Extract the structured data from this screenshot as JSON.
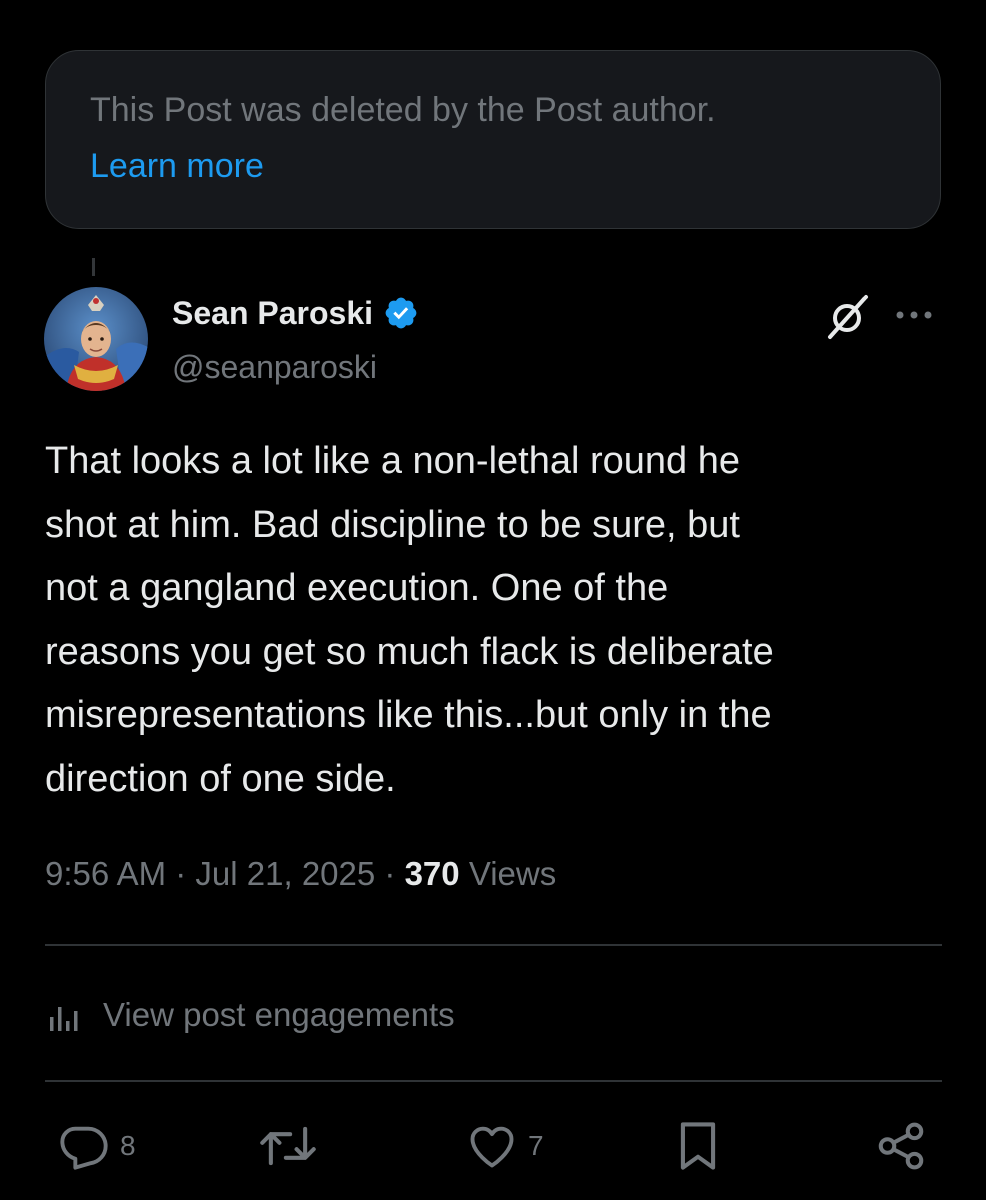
{
  "deleted_notice": {
    "text": "This Post was deleted by the Post author.",
    "link_label": "Learn more"
  },
  "author": {
    "name": "Sean Paroski",
    "handle": "@seanparoski",
    "verified": true,
    "avatar_icon": "avatar"
  },
  "post": {
    "text": "That looks a lot like a non-lethal round he\nshot at him. Bad discipline to be sure, but\nnot a gangland execution. One of the\nreasons you get so much flack is deliberate\nmisrepresentations like this...but only in the\ndirection of one side.",
    "time": "9:56 AM",
    "date": "Jul 21, 2025",
    "separator": "·",
    "views_count": "370",
    "views_label": "Views"
  },
  "engagements": {
    "label": "View post engagements",
    "icon": "bar-chart-icon"
  },
  "actions": {
    "reply": {
      "icon": "reply-icon",
      "count": "8"
    },
    "repost": {
      "icon": "repost-icon",
      "count": ""
    },
    "like": {
      "icon": "heart-icon",
      "count": "7"
    },
    "bookmark": {
      "icon": "bookmark-icon",
      "count": ""
    },
    "share": {
      "icon": "share-icon",
      "count": ""
    }
  },
  "colors": {
    "background": "#000000",
    "card": "#16181c",
    "text_primary": "#e7e9ea",
    "text_secondary": "#71767b",
    "link": "#1d9bf0",
    "verified_badge": "#1d9bf0",
    "divider": "#2f3336"
  }
}
